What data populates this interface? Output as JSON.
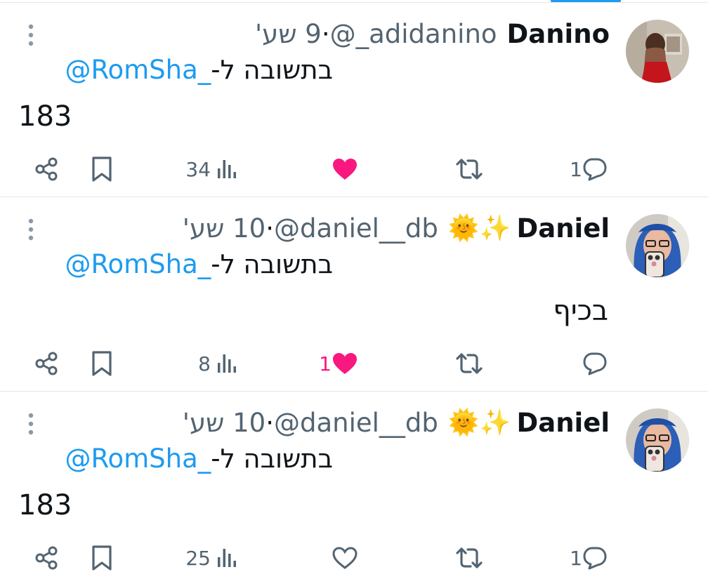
{
  "tweets": [
    {
      "name": "Danino",
      "emoji": "",
      "handle": "@_adidanino",
      "separator": "·",
      "time": "9 שע'",
      "reply_prefix": "בתשובה ל-",
      "reply_mention": "@RomSha_",
      "text": "183",
      "text_dir": "ltr",
      "views": "34",
      "likes": "",
      "liked": true,
      "retweets": "",
      "replies": "1",
      "avatar": "avatar-woman-red-dress"
    },
    {
      "name": "Daniel",
      "emoji": "🌞✨",
      "handle": "@daniel__db",
      "separator": "·",
      "time": "10 שע'",
      "reply_prefix": "בתשובה ל-",
      "reply_mention": "@RomSha_",
      "text": "בכיף",
      "text_dir": "rtl",
      "views": "8",
      "likes": "1",
      "liked": true,
      "retweets": "",
      "replies": "",
      "avatar": "avatar-blue-hair-selfie"
    },
    {
      "name": "Daniel",
      "emoji": "🌞✨",
      "handle": "@daniel__db",
      "separator": "·",
      "time": "10 שע'",
      "reply_prefix": "בתשובה ל-",
      "reply_mention": "@RomSha_",
      "text": "183",
      "text_dir": "ltr",
      "views": "25",
      "likes": "",
      "liked": false,
      "retweets": "",
      "replies": "1",
      "avatar": "avatar-blue-hair-selfie"
    }
  ],
  "colors": {
    "accent": "#1d9bf0",
    "like": "#f91880",
    "muted": "#536471",
    "text": "#0f1419"
  }
}
